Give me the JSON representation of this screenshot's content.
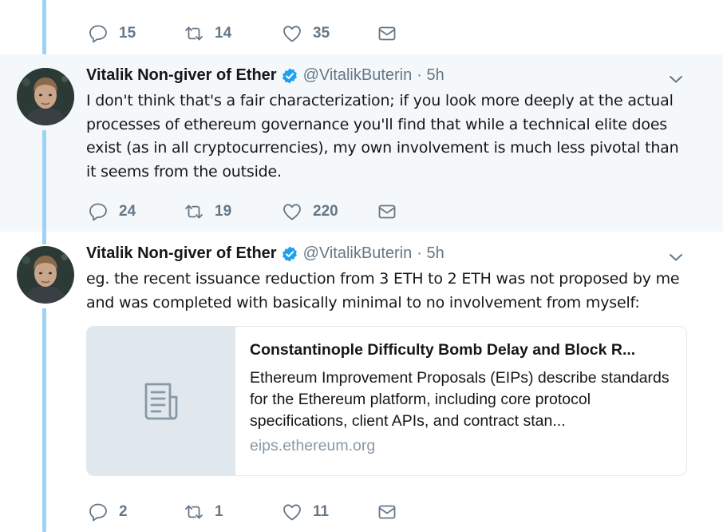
{
  "accent_color": "#1da1f2",
  "thread_line_color": "#9ed2f5",
  "top_actions": {
    "replies": "15",
    "retweets": "14",
    "likes": "35"
  },
  "tweets": [
    {
      "author_name": "Vitalik Non-giver of Ether",
      "verified": true,
      "handle": "@VitalikButerin",
      "time": "· 5h",
      "text": "I don't think that's a fair characterization; if you look more deeply at the actual processes of ethereum governance you'll find that while a technical elite does exist (as in all cryptocurrencies), my own involvement is much less pivotal than it seems from the outside.",
      "actions": {
        "replies": "24",
        "retweets": "19",
        "likes": "220"
      }
    },
    {
      "author_name": "Vitalik Non-giver of Ether",
      "verified": true,
      "handle": "@VitalikButerin",
      "time": "· 5h",
      "text": "eg. the recent issuance reduction from 3 ETH to 2 ETH was not proposed by me and was completed with basically minimal to no involvement from myself:",
      "card": {
        "icon": "document-icon",
        "title": "Constantinople Difficulty Bomb Delay and Block R...",
        "description": "Ethereum Improvement Proposals (EIPs) describe standards for the Ethereum platform, including core protocol specifications, client APIs, and contract stan...",
        "domain": "eips.ethereum.org"
      },
      "actions": {
        "replies": "2",
        "retweets": "1",
        "likes": "11"
      }
    }
  ]
}
